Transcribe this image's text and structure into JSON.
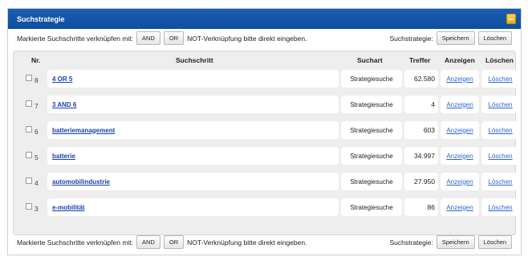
{
  "title": "Suchstrategie",
  "toolbar": {
    "combine_label": "Markierte Suchschritte verknüpfen mit:",
    "and_label": "AND",
    "or_label": "OR",
    "not_hint": "NOT-Verknüpfung bitte direkt eingeben.",
    "strategy_label": "Suchstrategie:",
    "save_label": "Speichern",
    "delete_label": "Löschen"
  },
  "footer": {
    "combine_label": "Markierte Suchschritte verknüpfen mit:",
    "and_label": "AND",
    "or_label": "OR",
    "not_hint": "NOT-Verknüpfung bitte direkt eingeben.",
    "strategy_label": "Suchstrategie:",
    "save_label": "Speichern",
    "delete_label": "Löschen"
  },
  "table": {
    "headers": {
      "nr": "Nr.",
      "step": "Suchschritt",
      "type": "Suchart",
      "hits": "Treffer",
      "show": "Anzeigen",
      "delete": "Löschen"
    },
    "rows": [
      {
        "nr": "8",
        "step": "4 OR 5",
        "type": "Strategiesuche",
        "hits": "62.580",
        "show": "Anzeigen",
        "delete": "Löschen"
      },
      {
        "nr": "7",
        "step": "3 AND 6",
        "type": "Strategiesuche",
        "hits": "4",
        "show": "Anzeigen",
        "delete": "Löschen"
      },
      {
        "nr": "6",
        "step": "batteriemanagement",
        "type": "Strategiesuche",
        "hits": "603",
        "show": "Anzeigen",
        "delete": "Löschen"
      },
      {
        "nr": "5",
        "step": "batterie",
        "type": "Strategiesuche",
        "hits": "34.997",
        "show": "Anzeigen",
        "delete": "Löschen"
      },
      {
        "nr": "4",
        "step": "automobilindustrie",
        "type": "Strategiesuche",
        "hits": "27.950",
        "show": "Anzeigen",
        "delete": "Löschen"
      },
      {
        "nr": "3",
        "step": "e-mobilität",
        "type": "Strategiesuche",
        "hits": "86",
        "show": "Anzeigen",
        "delete": "Löschen"
      }
    ]
  },
  "colors": {
    "titlebar": "#0d4f9e",
    "link": "#1a3faf",
    "accent_button": "#f0a817"
  },
  "icons": {
    "collapse": "collapse-icon"
  }
}
